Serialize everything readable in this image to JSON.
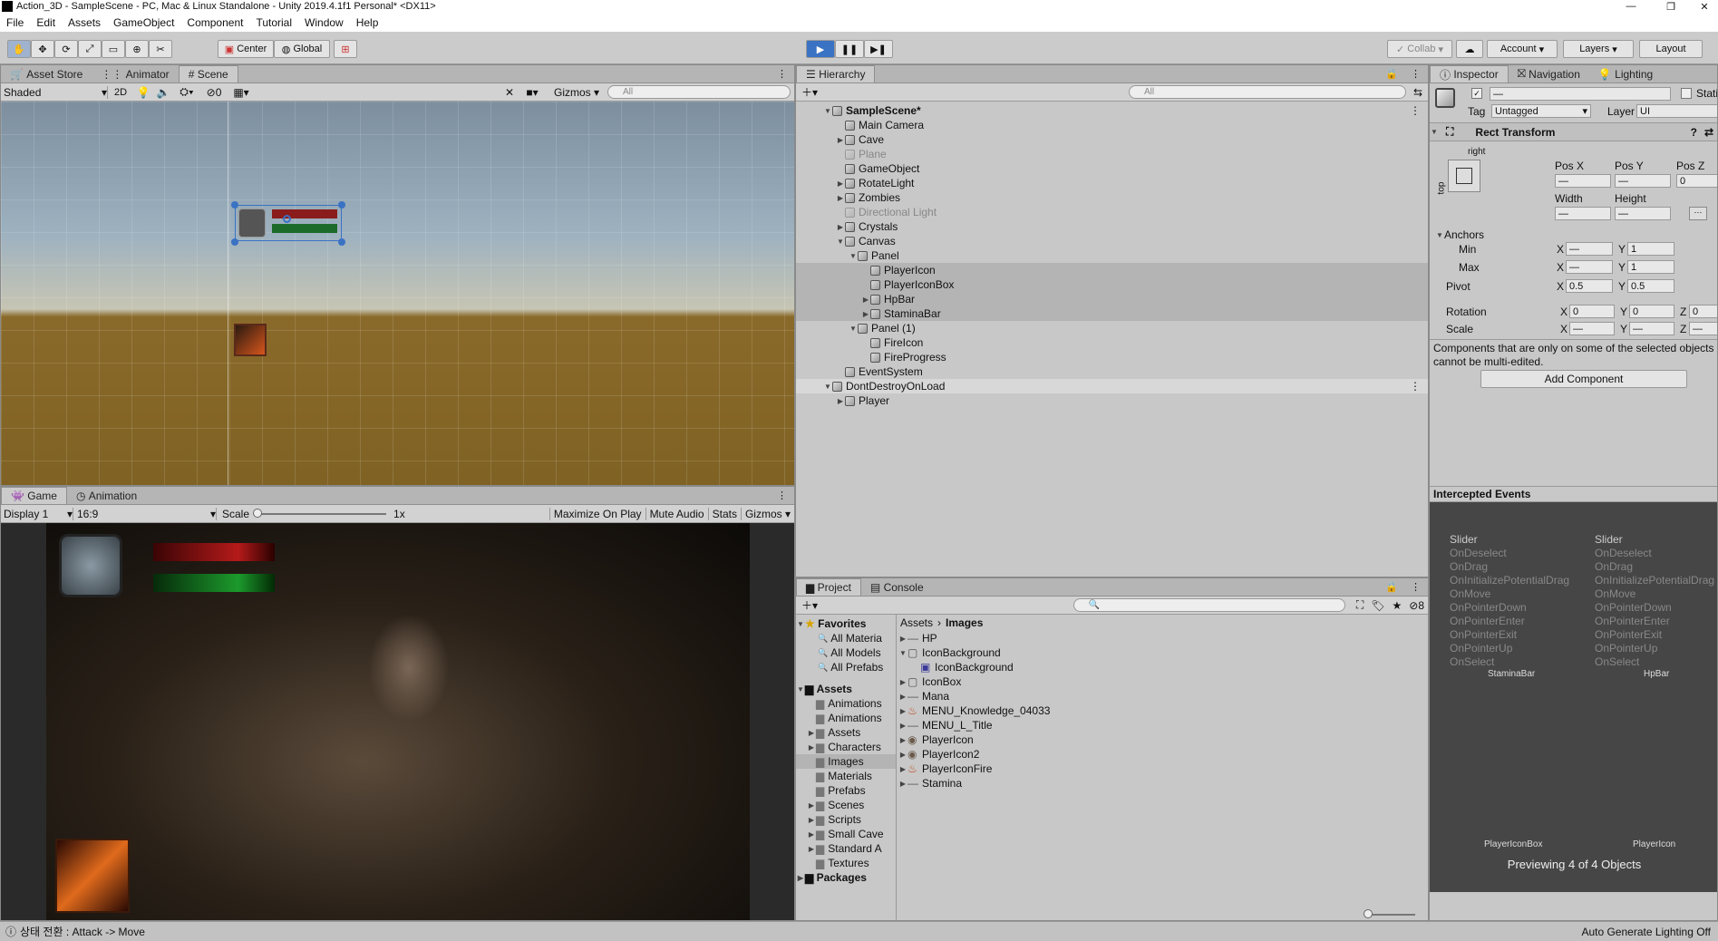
{
  "window": {
    "title": "Action_3D - SampleScene - PC, Mac & Linux Standalone - Unity 2019.4.1f1 Personal* <DX11>"
  },
  "menu": [
    "File",
    "Edit",
    "Assets",
    "GameObject",
    "Component",
    "Tutorial",
    "Window",
    "Help"
  ],
  "toolbar": {
    "center": "Center",
    "global": "Global",
    "collab": "Collab",
    "account": "Account",
    "layers": "Layers",
    "layout": "Layout"
  },
  "scene": {
    "tabs": [
      "Asset Store",
      "Animator",
      "Scene"
    ],
    "shading": "Shaded",
    "mode2d": "2D",
    "fx_count": "0",
    "gizmos": "Gizmos",
    "search": "All"
  },
  "game": {
    "tabs": [
      "Game",
      "Animation"
    ],
    "display": "Display 1",
    "aspect": "16:9",
    "scale_label": "Scale",
    "scale_value": "1x",
    "maximize": "Maximize On Play",
    "mute": "Mute Audio",
    "stats": "Stats",
    "gizmos": "Gizmos"
  },
  "hierarchy": {
    "tab": "Hierarchy",
    "search": "All",
    "items": [
      {
        "label": "SampleScene*",
        "depth": 0,
        "exp": "▼",
        "bold": true,
        "hl": false,
        "dim": false
      },
      {
        "label": "Main Camera",
        "depth": 1,
        "exp": "",
        "bold": false,
        "hl": false,
        "dim": false
      },
      {
        "label": "Cave",
        "depth": 1,
        "exp": "▶",
        "bold": false,
        "hl": false,
        "dim": false
      },
      {
        "label": "Plane",
        "depth": 1,
        "exp": "",
        "bold": false,
        "hl": false,
        "dim": true
      },
      {
        "label": "GameObject",
        "depth": 1,
        "exp": "",
        "bold": false,
        "hl": false,
        "dim": false
      },
      {
        "label": "RotateLight",
        "depth": 1,
        "exp": "▶",
        "bold": false,
        "hl": false,
        "dim": false
      },
      {
        "label": "Zombies",
        "depth": 1,
        "exp": "▶",
        "bold": false,
        "hl": false,
        "dim": false
      },
      {
        "label": "Directional Light",
        "depth": 1,
        "exp": "",
        "bold": false,
        "hl": false,
        "dim": true
      },
      {
        "label": "Crystals",
        "depth": 1,
        "exp": "▶",
        "bold": false,
        "hl": false,
        "dim": false
      },
      {
        "label": "Canvas",
        "depth": 1,
        "exp": "▼",
        "bold": false,
        "hl": false,
        "dim": false
      },
      {
        "label": "Panel",
        "depth": 2,
        "exp": "▼",
        "bold": false,
        "hl": false,
        "dim": false
      },
      {
        "label": "PlayerIcon",
        "depth": 3,
        "exp": "",
        "bold": false,
        "hl": true,
        "dim": false
      },
      {
        "label": "PlayerIconBox",
        "depth": 3,
        "exp": "",
        "bold": false,
        "hl": true,
        "dim": false
      },
      {
        "label": "HpBar",
        "depth": 3,
        "exp": "▶",
        "bold": false,
        "hl": true,
        "dim": false
      },
      {
        "label": "StaminaBar",
        "depth": 3,
        "exp": "▶",
        "bold": false,
        "hl": true,
        "dim": false
      },
      {
        "label": "Panel (1)",
        "depth": 2,
        "exp": "▼",
        "bold": false,
        "hl": false,
        "dim": false
      },
      {
        "label": "FireIcon",
        "depth": 3,
        "exp": "",
        "bold": false,
        "hl": false,
        "dim": false
      },
      {
        "label": "FireProgress",
        "depth": 3,
        "exp": "",
        "bold": false,
        "hl": false,
        "dim": false
      },
      {
        "label": "EventSystem",
        "depth": 1,
        "exp": "",
        "bold": false,
        "hl": false,
        "dim": false
      },
      {
        "label": "DontDestroyOnLoad",
        "depth": 0,
        "exp": "▼",
        "bold": false,
        "hl": false,
        "dim": false
      },
      {
        "label": "Player",
        "depth": 1,
        "exp": "▶",
        "bold": false,
        "hl": false,
        "dim": false
      }
    ]
  },
  "project": {
    "tabs": [
      "Project",
      "Console"
    ],
    "hidden_count": "8",
    "breadcrumb": [
      "Assets",
      "Images"
    ],
    "favorites_label": "Favorites",
    "favorites": [
      "All Materia",
      "All Models",
      "All Prefabs"
    ],
    "assets_label": "Assets",
    "folders": [
      {
        "label": "Animations",
        "exp": ""
      },
      {
        "label": "Animations",
        "exp": ""
      },
      {
        "label": "Assets",
        "exp": "▶"
      },
      {
        "label": "Characters",
        "exp": "▶"
      },
      {
        "label": "Images",
        "exp": ""
      },
      {
        "label": "Materials",
        "exp": ""
      },
      {
        "label": "Prefabs",
        "exp": ""
      },
      {
        "label": "Scenes",
        "exp": "▶"
      },
      {
        "label": "Scripts",
        "exp": "▶"
      },
      {
        "label": "Small Cave",
        "exp": "▶"
      },
      {
        "label": "Standard A",
        "exp": "▶"
      },
      {
        "label": "Textures",
        "exp": ""
      }
    ],
    "packages_label": "Packages",
    "files": [
      {
        "label": "HP",
        "exp": "▶",
        "indent": 0,
        "icon": "line-icon"
      },
      {
        "label": "IconBackground",
        "exp": "▼",
        "indent": 0,
        "icon": "box-icon"
      },
      {
        "label": "IconBackground",
        "exp": "",
        "indent": 1,
        "icon": "sprite-icon"
      },
      {
        "label": "IconBox",
        "exp": "▶",
        "indent": 0,
        "icon": "box-icon"
      },
      {
        "label": "Mana",
        "exp": "▶",
        "indent": 0,
        "icon": "line-icon"
      },
      {
        "label": "MENU_Knowledge_04033",
        "exp": "▶",
        "indent": 0,
        "icon": "fire-icon"
      },
      {
        "label": "MENU_L_Title",
        "exp": "▶",
        "indent": 0,
        "icon": "line-icon"
      },
      {
        "label": "PlayerIcon",
        "exp": "▶",
        "indent": 0,
        "icon": "round-icon"
      },
      {
        "label": "PlayerIcon2",
        "exp": "▶",
        "indent": 0,
        "icon": "round-icon"
      },
      {
        "label": "PlayerIconFire",
        "exp": "▶",
        "indent": 0,
        "icon": "fire-icon"
      },
      {
        "label": "Stamina",
        "exp": "▶",
        "indent": 0,
        "icon": "line-icon"
      }
    ]
  },
  "inspector": {
    "tabs": [
      "Inspector",
      "Navigation",
      "Lighting"
    ],
    "name_value": "—",
    "static_label": "Stati",
    "tag_label": "Tag",
    "tag_value": "Untagged",
    "layer_label": "Layer",
    "layer_value": "UI",
    "rect_title": "Rect Transform",
    "anchor_h": "right",
    "anchor_v": "top",
    "posx": "Pos X",
    "posy": "Pos Y",
    "posz": "Pos Z",
    "posx_v": "—",
    "posy_v": "—",
    "posz_v": "0",
    "width": "Width",
    "height": "Height",
    "width_v": "—",
    "height_v": "—",
    "anchors": "Anchors",
    "min": "Min",
    "max": "Max",
    "pivot": "Pivot",
    "rotation": "Rotation",
    "scale": "Scale",
    "x": "X",
    "y": "Y",
    "z": "Z",
    "min_x": "—",
    "min_y": "1",
    "max_x": "—",
    "max_y": "1",
    "pivot_x": "0.5",
    "pivot_y": "0.5",
    "rot_x": "0",
    "rot_y": "0",
    "rot_z": "0",
    "scale_x": "—",
    "scale_y": "—",
    "scale_z": "—",
    "multi_note": "Components that are only on some of the selected objects cannot be multi-edited.",
    "add_component": "Add Component"
  },
  "events": {
    "title": "Intercepted Events",
    "col1": {
      "name": "Slider",
      "items": [
        "OnDeselect",
        "OnDrag",
        "OnInitializePotentialDrag",
        "OnMove",
        "OnPointerDown",
        "OnPointerEnter",
        "OnPointerExit",
        "OnPointerUp",
        "OnSelect"
      ],
      "footer": "StaminaBar"
    },
    "col2": {
      "name": "Slider",
      "items": [
        "OnDeselect",
        "OnDrag",
        "OnInitializePotentialDrag",
        "OnMove",
        "OnPointerDown",
        "OnPointerEnter",
        "OnPointerExit",
        "OnPointerUp",
        "OnSelect"
      ],
      "footer": "HpBar"
    },
    "label_a": "PlayerIconBox",
    "label_b": "PlayerIcon",
    "preview": "Previewing 4 of 4 Objects"
  },
  "statusbar": {
    "message": "상태 전환 : Attack -> Move",
    "right": "Auto Generate Lighting Off"
  },
  "colors": {
    "accent": "#3a72c4",
    "sky": "#a8b9c6",
    "ground": "#8a6a2a"
  }
}
